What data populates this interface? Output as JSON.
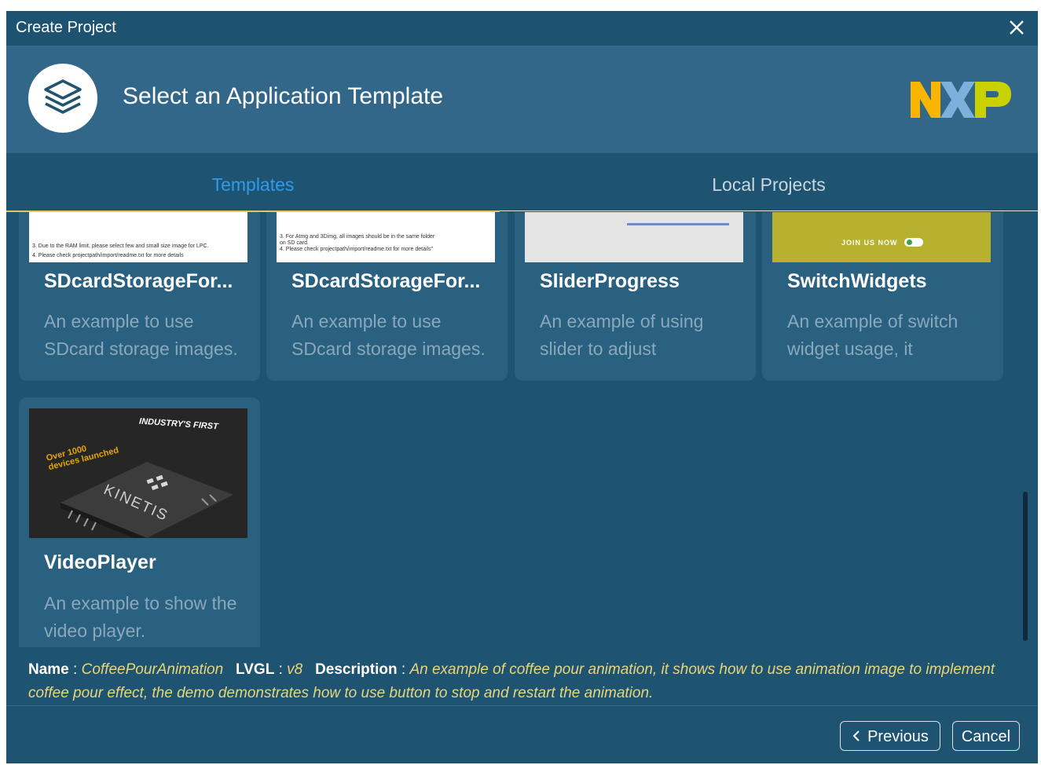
{
  "window": {
    "title": "Create Project"
  },
  "header": {
    "heading": "Select an Application Template"
  },
  "brand": {
    "logo_text": "NXP",
    "colors": {
      "n": "#f9b500",
      "x": "#7bb1db",
      "p": "#c9d200"
    }
  },
  "tabs": [
    {
      "label": "Templates",
      "active": true
    },
    {
      "label": "Local Projects",
      "active": false
    }
  ],
  "cards": [
    {
      "name": "SDcardStorageFor...",
      "description": "An example to use SDcard storage images.",
      "thumb_lines": [
        "3. Due to the RAM limit, please select few and small size image for LPC.",
        "4. Please check projectpath/import/readme.txt for more details"
      ]
    },
    {
      "name": "SDcardStorageFor...",
      "description": "An example to use SDcard storage images.",
      "thumb_lines": [
        "3. For Atmg and 3Dimg, all images should be in the same folder",
        "on SD card.",
        "4. Please check projectpath/import/readme.txt for more details\""
      ]
    },
    {
      "name": "SliderProgress",
      "description": "An example of using slider to adjust"
    },
    {
      "name": "SwitchWidgets",
      "description": "An example of switch widget usage, it",
      "thumb_text": "JOIN US NOW"
    },
    {
      "name": "VideoPlayer",
      "description": "An example to show the video player.",
      "thumb_texts": {
        "industry": "INDUSTRY'S FIRST",
        "devices": "Over 1000 devices launched",
        "chip": "KINETIS"
      }
    }
  ],
  "info": {
    "name_label": "Name",
    "name_value": "CoffeePourAnimation",
    "lvgl_label": "LVGL",
    "lvgl_value": "v8",
    "desc_label": "Description",
    "desc_value": "An example of coffee pour animation, it shows how to use animation image to implement coffee pour effect, the demo demonstrates how to use button to stop and restart the animation."
  },
  "buttons": {
    "previous": "Previous",
    "cancel": "Cancel"
  },
  "scroll": {
    "position_fraction": 0.62
  },
  "theme": {
    "accent": "#2f9bea",
    "info_text": "#e8d57a",
    "background": "#1e5471"
  }
}
